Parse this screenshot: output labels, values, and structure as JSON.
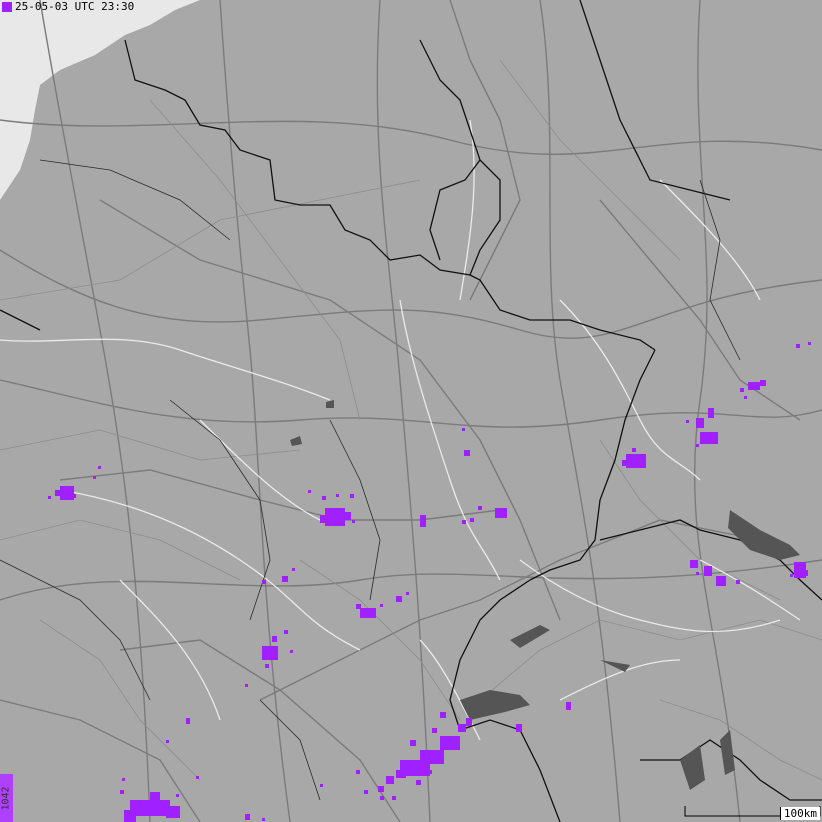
{
  "header": {
    "timestamp": "25-05-03 UTC 23:30"
  },
  "legend": {
    "count": "1042"
  },
  "scale": {
    "label": "100km"
  },
  "colors": {
    "land": "#a8a8a8",
    "sea": "#e6e6e6",
    "border": "#111111",
    "road": "#7a7a7a",
    "river": "#f0f0f0",
    "lake": "#555555",
    "strike": "#a020ff",
    "badge": "#b040ff"
  }
}
